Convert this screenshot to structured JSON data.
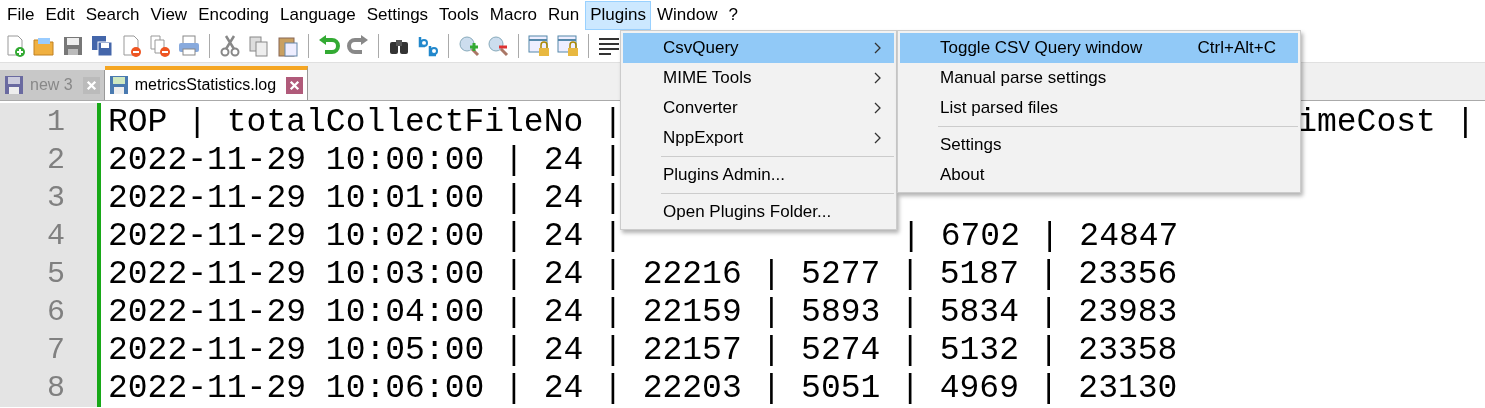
{
  "menu_bar": [
    {
      "label": "File",
      "selected": false
    },
    {
      "label": "Edit",
      "selected": false
    },
    {
      "label": "Search",
      "selected": false
    },
    {
      "label": "View",
      "selected": false
    },
    {
      "label": "Encoding",
      "selected": false
    },
    {
      "label": "Language",
      "selected": false
    },
    {
      "label": "Settings",
      "selected": false
    },
    {
      "label": "Tools",
      "selected": false
    },
    {
      "label": "Macro",
      "selected": false
    },
    {
      "label": "Run",
      "selected": false
    },
    {
      "label": "Plugins",
      "selected": true
    },
    {
      "label": "Window",
      "selected": false
    },
    {
      "label": "?",
      "selected": false
    }
  ],
  "toolbar": [
    {
      "kind": "new"
    },
    {
      "kind": "open"
    },
    {
      "kind": "save"
    },
    {
      "kind": "saveall"
    },
    {
      "kind": "close"
    },
    {
      "kind": "closeall"
    },
    {
      "kind": "print"
    },
    {
      "kind": "sep"
    },
    {
      "kind": "cut"
    },
    {
      "kind": "copy"
    },
    {
      "kind": "paste"
    },
    {
      "kind": "sep"
    },
    {
      "kind": "undo"
    },
    {
      "kind": "redo"
    },
    {
      "kind": "sep"
    },
    {
      "kind": "find"
    },
    {
      "kind": "replace"
    },
    {
      "kind": "sep"
    },
    {
      "kind": "zoomin"
    },
    {
      "kind": "zoomout"
    },
    {
      "kind": "sep"
    },
    {
      "kind": "syncv"
    },
    {
      "kind": "synch"
    },
    {
      "kind": "sep"
    },
    {
      "kind": "wrap"
    }
  ],
  "tabs": [
    {
      "label": "new 3",
      "selected": false
    },
    {
      "label": "metricsStatistics.log",
      "selected": true
    }
  ],
  "editor": {
    "lines": [
      {
        "number": "1",
        "segments": [
          "ROP | totalCollectFileNo |",
          "imeCost |"
        ]
      },
      {
        "number": "2",
        "segments": [
          "2022-11-29 10:00:00 | 24 |"
        ]
      },
      {
        "number": "3",
        "segments": [
          "2022-11-29 10:01:00 | 24 |"
        ]
      },
      {
        "number": "4",
        "segments": [
          "2022-11-29 10:02:00 | 24 |",
          "| 6702 | 24847"
        ]
      },
      {
        "number": "5",
        "segments": [
          "2022-11-29 10:03:00 | 24 | 22216 | 5277 | 5187 | 23356"
        ]
      },
      {
        "number": "6",
        "segments": [
          "2022-11-29 10:04:00 | 24 | 22159 | 5893 | 5834 | 23983"
        ]
      },
      {
        "number": "7",
        "segments": [
          "2022-11-29 10:05:00 | 24 | 22157 | 5274 | 5132 | 23358"
        ]
      },
      {
        "number": "8",
        "segments": [
          "2022-11-29 10:06:00 | 24 | 22203 | 5051 | 4969 | 23130"
        ]
      }
    ]
  },
  "plugins_menu": [
    {
      "kind": "item",
      "label": "CsvQuery",
      "submenu": true,
      "selected": true
    },
    {
      "kind": "item",
      "label": "MIME Tools",
      "submenu": true,
      "selected": false
    },
    {
      "kind": "item",
      "label": "Converter",
      "submenu": true,
      "selected": false
    },
    {
      "kind": "item",
      "label": "NppExport",
      "submenu": true,
      "selected": false
    },
    {
      "kind": "separator"
    },
    {
      "kind": "item",
      "label": "Plugins Admin...",
      "submenu": false,
      "selected": false
    },
    {
      "kind": "separator"
    },
    {
      "kind": "item",
      "label": "Open Plugins Folder...",
      "submenu": false,
      "selected": false
    }
  ],
  "csvquery_submenu": [
    {
      "kind": "item",
      "label": "Toggle CSV Query window",
      "shortcut": "Ctrl+Alt+C",
      "selected": true
    },
    {
      "kind": "item",
      "label": "Manual parse settings",
      "selected": false
    },
    {
      "kind": "item",
      "label": "List parsed files",
      "selected": false
    },
    {
      "kind": "separator"
    },
    {
      "kind": "item",
      "label": "Settings",
      "selected": false
    },
    {
      "kind": "item",
      "label": "About",
      "selected": false
    }
  ]
}
